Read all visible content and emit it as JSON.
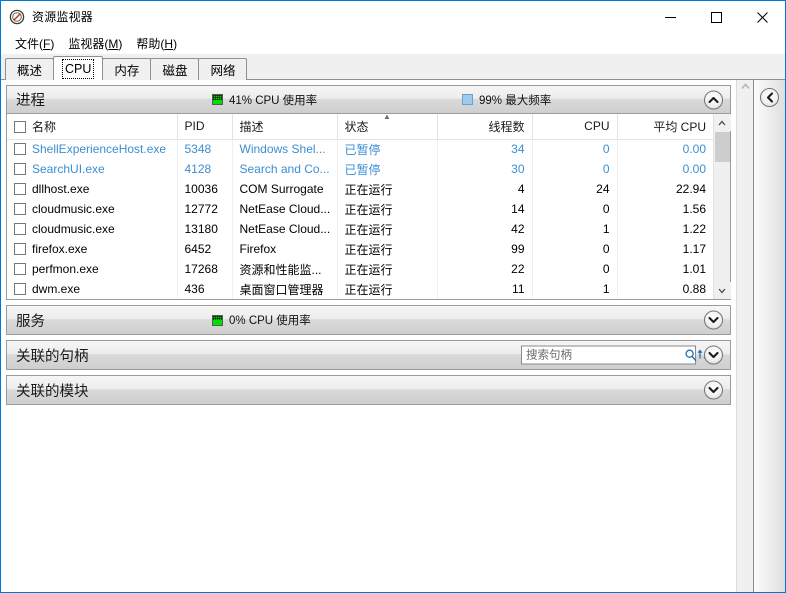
{
  "window": {
    "title": "资源监视器",
    "app_icon": "resource-monitor-icon",
    "minimize_label": "—",
    "maximize_label": "□",
    "close_label": "✕",
    "border_color": "#0078d7"
  },
  "menubar": [
    {
      "label": "文件",
      "accel": "F"
    },
    {
      "label": "监视器",
      "accel": "M"
    },
    {
      "label": "帮助",
      "accel": "H"
    }
  ],
  "tabs": [
    {
      "label": "概述",
      "active": false
    },
    {
      "label": "CPU",
      "active": true
    },
    {
      "label": "内存",
      "active": false
    },
    {
      "label": "磁盘",
      "active": false
    },
    {
      "label": "网络",
      "active": false
    }
  ],
  "panels": {
    "processes": {
      "title": "进程",
      "stats": [
        {
          "label": "41% CPU 使用率",
          "swatch": "green"
        },
        {
          "label": "99% 最大频率",
          "swatch": "blue"
        }
      ],
      "expanded": true,
      "chevron": "chevron-up-icon",
      "columns": [
        {
          "key": "name",
          "label": "名称",
          "align": "left"
        },
        {
          "key": "pid",
          "label": "PID",
          "align": "left"
        },
        {
          "key": "desc",
          "label": "描述",
          "align": "left"
        },
        {
          "key": "status",
          "label": "状态",
          "align": "left",
          "sorted": "asc"
        },
        {
          "key": "threads",
          "label": "线程数",
          "align": "right"
        },
        {
          "key": "cpu",
          "label": "CPU",
          "align": "right"
        },
        {
          "key": "avgcpu",
          "label": "平均 CPU",
          "align": "right"
        }
      ],
      "rows": [
        {
          "name": "ShellExperienceHost.exe",
          "pid": "5348",
          "desc": "Windows Shel...",
          "status": "已暂停",
          "threads": "34",
          "cpu": "0",
          "avgcpu": "0.00",
          "suspended": true
        },
        {
          "name": "SearchUI.exe",
          "pid": "4128",
          "desc": "Search and Co...",
          "status": "已暂停",
          "threads": "30",
          "cpu": "0",
          "avgcpu": "0.00",
          "suspended": true
        },
        {
          "name": "dllhost.exe",
          "pid": "10036",
          "desc": "COM Surrogate",
          "status": "正在运行",
          "threads": "4",
          "cpu": "24",
          "avgcpu": "22.94",
          "suspended": false
        },
        {
          "name": "cloudmusic.exe",
          "pid": "12772",
          "desc": "NetEase Cloud...",
          "status": "正在运行",
          "threads": "14",
          "cpu": "0",
          "avgcpu": "1.56",
          "suspended": false
        },
        {
          "name": "cloudmusic.exe",
          "pid": "13180",
          "desc": "NetEase Cloud...",
          "status": "正在运行",
          "threads": "42",
          "cpu": "1",
          "avgcpu": "1.22",
          "suspended": false
        },
        {
          "name": "firefox.exe",
          "pid": "6452",
          "desc": "Firefox",
          "status": "正在运行",
          "threads": "99",
          "cpu": "0",
          "avgcpu": "1.17",
          "suspended": false
        },
        {
          "name": "perfmon.exe",
          "pid": "17268",
          "desc": "资源和性能监...",
          "status": "正在运行",
          "threads": "22",
          "cpu": "0",
          "avgcpu": "1.01",
          "suspended": false
        },
        {
          "name": "dwm.exe",
          "pid": "436",
          "desc": "桌面窗口管理器",
          "status": "正在运行",
          "threads": "11",
          "cpu": "1",
          "avgcpu": "0.88",
          "suspended": false
        }
      ]
    },
    "services": {
      "title": "服务",
      "stat": {
        "label": "0% CPU 使用率",
        "swatch": "green"
      },
      "expanded": false,
      "chevron": "chevron-down-icon"
    },
    "handles": {
      "title": "关联的句柄",
      "search_placeholder": "搜索句柄",
      "search_value": "",
      "search_icon": "search-icon",
      "refresh_icon": "refresh-icon",
      "expanded": false,
      "chevron": "chevron-down-icon"
    },
    "modules": {
      "title": "关联的模块",
      "expanded": false,
      "chevron": "chevron-down-icon"
    }
  },
  "right_panel": {
    "expand_icon": "chevron-left-icon"
  },
  "scrollbars": {
    "outer_up": "▲",
    "table_up": "▲",
    "table_down": "▼"
  }
}
